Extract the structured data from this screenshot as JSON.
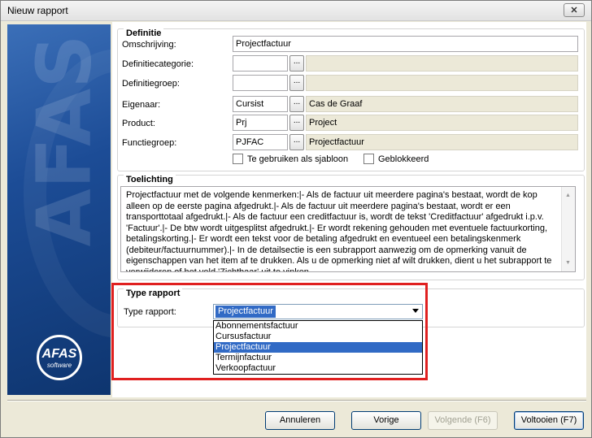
{
  "window": {
    "title": "Nieuw rapport",
    "close_symbol": "✕"
  },
  "logo": {
    "watermark": "AFAS",
    "badge_main": "AFAS",
    "badge_sub": "software"
  },
  "definitie": {
    "title": "Definitie",
    "omschrijving_label": "Omschrijving:",
    "omschrijving_value": "Projectfactuur",
    "definitiecategorie_label": "Definitiecategorie:",
    "definitiegroep_label": "Definitiegroep:",
    "eigenaar_label": "Eigenaar:",
    "eigenaar_value": "Cursist",
    "eigenaar_desc": "Cas de Graaf",
    "product_label": "Product:",
    "product_value": "Prj",
    "product_desc": "Project",
    "functiegroep_label": "Functiegroep:",
    "functiegroep_value": "PJFAC",
    "functiegroep_desc": "Projectfactuur",
    "sjabloon_label": "Te gebruiken als sjabloon",
    "geblokkeerd_label": "Geblokkeerd",
    "lookup_symbol": "..."
  },
  "toelichting": {
    "title": "Toelichting",
    "text": "Projectfactuur met de volgende kenmerken:|- Als de factuur uit meerdere pagina's bestaat, wordt de kop alleen op de eerste pagina afgedrukt.|- Als de factuur uit meerdere pagina's bestaat, wordt er een transporttotaal afgedrukt.|- Als de factuur een creditfactuur is, wordt de tekst 'Creditfactuur' afgedrukt i.p.v. 'Factuur'.|- De btw wordt uitgesplitst afgedrukt.|- Er wordt rekening gehouden met eventuele factuurkorting, betalingskorting.|- Er wordt een tekst voor de betaling afgedrukt en eventueel een betalingskenmerk (debiteur/factuurnummer).|- In de detailsectie is een subrapport aanwezig om de opmerking vanuit de eigenschappen van het item af te drukken. Als u de opmerking niet af wilt drukken, dient u het subrapport te verwijderen of het veld 'Zichtbaar' uit te vinken."
  },
  "type_rapport": {
    "title": "Type rapport",
    "label": "Type rapport:",
    "selected": "Projectfactuur",
    "options": [
      "Abonnementsfactuur",
      "Cursusfactuur",
      "Projectfactuur",
      "Termijnfactuur",
      "Verkoopfactuur"
    ]
  },
  "buttons": {
    "annuleren": "Annuleren",
    "vorige": "Vorige",
    "volgende": "Volgende (F6)",
    "voltooien": "Voltooien (F7)"
  },
  "colors": {
    "highlight": "#316ac5",
    "annotation_box": "#e02020"
  }
}
